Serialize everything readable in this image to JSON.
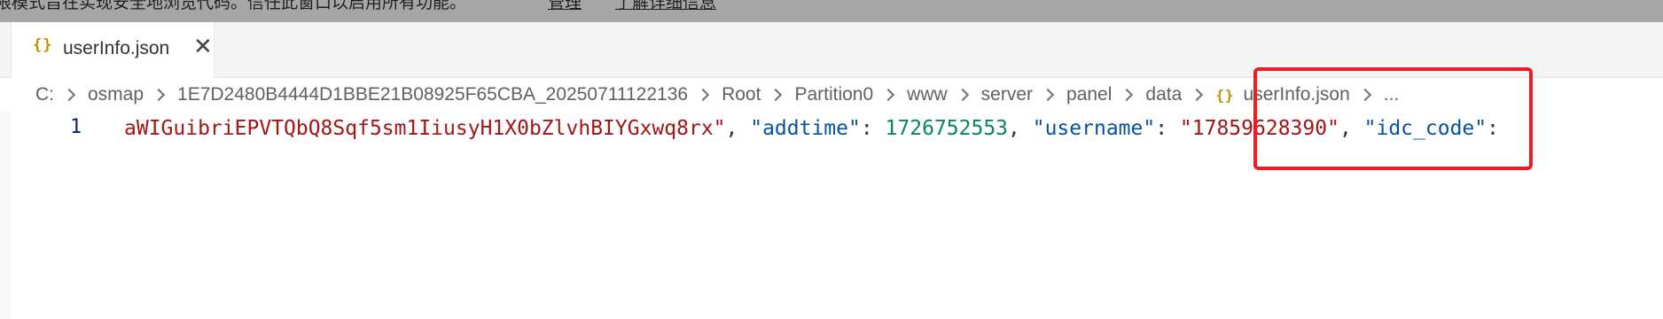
{
  "banner": {
    "message": "限模式旨在实现安全地浏览代码。信任此窗口以启用所有功能。",
    "manage_link": "管理",
    "learn_more_link": "了解详细信息"
  },
  "tabs": [
    {
      "label": "userInfo.json",
      "icon": "json-braces-icon",
      "close": "✕"
    }
  ],
  "breadcrumb": {
    "items": [
      "C:",
      "osmap",
      "1E7D2480B4444D1BBE21B08925F65CBA_20250711122136",
      "Root",
      "Partition0",
      "www",
      "server",
      "panel",
      "data"
    ],
    "file": "userInfo.json",
    "ellipsis": "..."
  },
  "editor": {
    "line_number": "1",
    "tokens": {
      "t1": "aWIGuibriEPVTQbQ8Sqf5sm1IiusyH1X0bZlvhBIYGxwq8rx\"",
      "t2": ", ",
      "t3": "\"addtime\"",
      "t4": ": ",
      "t5": "1726752553",
      "t6": ", ",
      "t7": "\"username\"",
      "t8": ": ",
      "t9": "\"17859628390\"",
      "t10": ", ",
      "t11": "\"idc_code\"",
      "t12": ":"
    }
  },
  "colors": {
    "string": "#a31515",
    "key": "#0451a5",
    "number": "#098658",
    "annotation": "#ec1c24",
    "banner_bg": "#a6a6a6"
  }
}
